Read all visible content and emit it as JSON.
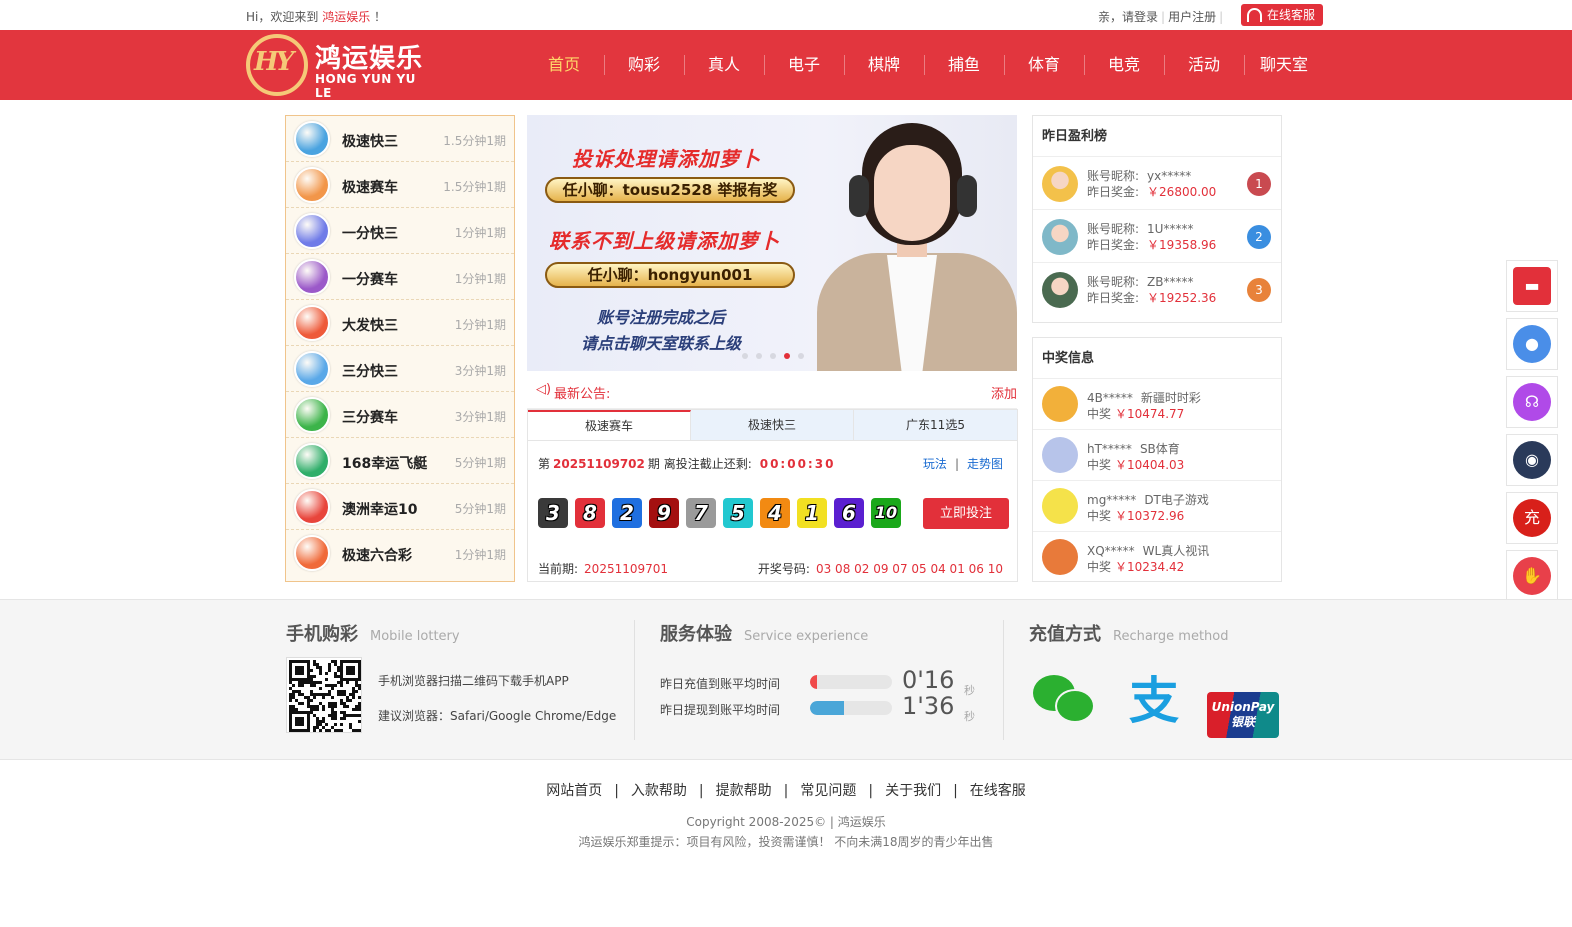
{
  "topbar": {
    "welcome_prefix": "Hi，欢迎来到",
    "brand": "鸿运娱乐",
    "welcome_suffix": "！",
    "greet": "亲，请登录",
    "register": "用户注册",
    "cs_button": "在线客服"
  },
  "logo": {
    "cn": "鸿运娱乐",
    "en": "HONG YUN YU LE",
    "mark": "HY"
  },
  "nav": [
    "首页",
    "购彩",
    "真人",
    "电子",
    "棋牌",
    "捕鱼",
    "体育",
    "电竞",
    "活动",
    "聊天室"
  ],
  "lotteries": [
    {
      "name": "极速快三",
      "period": "1.5分钟1期",
      "color": "#4aa3e0"
    },
    {
      "name": "极速赛车",
      "period": "1.5分钟1期",
      "color": "#f2964a"
    },
    {
      "name": "一分快三",
      "period": "1分钟1期",
      "color": "#6f7be8"
    },
    {
      "name": "一分赛车",
      "period": "1分钟1期",
      "color": "#9b59c9"
    },
    {
      "name": "大发快三",
      "period": "1分钟1期",
      "color": "#ee5a3a"
    },
    {
      "name": "三分快三",
      "period": "3分钟1期",
      "color": "#5aa8e8"
    },
    {
      "name": "三分赛车",
      "period": "3分钟1期",
      "color": "#3cb44a"
    },
    {
      "name": "168幸运飞艇",
      "period": "5分钟1期",
      "color": "#2fae6a"
    },
    {
      "name": "澳洲幸运10",
      "period": "5分钟1期",
      "color": "#e8453c"
    },
    {
      "name": "极速六合彩",
      "period": "1分钟1期",
      "color": "#f06a3a"
    }
  ],
  "banner": {
    "line1": "投诉处理请添加萝卜",
    "pill1": "任小聊：tousu2528 举报有奖",
    "line2": "联系不到上级请添加萝卜",
    "pill2": "任小聊：hongyun001",
    "line3": "账号注册完成之后",
    "line4": "请点击聊天室联系上级"
  },
  "notice": {
    "label": "最新公告:",
    "text": "添加"
  },
  "game": {
    "tabs": [
      "极速赛车",
      "极速快三",
      "广东11选5"
    ],
    "issue_prefix": "第",
    "issue_no": "20251109702",
    "issue_suffix": "期 离投注截止还剩:",
    "timer": "00:00:30",
    "link_play": "玩法",
    "link_trend": "走势图",
    "balls": [
      {
        "n": "3",
        "color": "#3a3a3a"
      },
      {
        "n": "8",
        "color": "#e2303a"
      },
      {
        "n": "2",
        "color": "#1f6fe0"
      },
      {
        "n": "9",
        "color": "#a41010"
      },
      {
        "n": "7",
        "color": "#9a9a9a"
      },
      {
        "n": "5",
        "color": "#22c8d0"
      },
      {
        "n": "4",
        "color": "#f28a12"
      },
      {
        "n": "1",
        "color": "#f2e022"
      },
      {
        "n": "6",
        "color": "#5a1fd0"
      },
      {
        "n": "10",
        "color": "#1aa81a"
      }
    ],
    "bet_button": "立即投注",
    "current_label": "当前期:",
    "current_no": "20251109701",
    "draw_label": "开奖号码:",
    "draw_numbers": "03 08 02 09 07 05 04 01 06 10"
  },
  "rank": {
    "title": "昨日盈利榜",
    "nick_label": "账号昵称:",
    "prize_label": "昨日奖金:",
    "items": [
      {
        "nick": "yx*****",
        "amount": "￥26800.00",
        "rank": "1",
        "color": "#c94a50",
        "avatar": "#f3c14a"
      },
      {
        "nick": "1U*****",
        "amount": "￥19358.96",
        "rank": "2",
        "color": "#3a8ee0",
        "avatar": "#7fb8c8"
      },
      {
        "nick": "ZB*****",
        "amount": "￥19252.36",
        "rank": "3",
        "color": "#e8823a",
        "avatar": "#4a6a50"
      }
    ]
  },
  "wins": {
    "title": "中奖信息",
    "won_label": "中奖",
    "items": [
      {
        "user": "4B*****",
        "game": "新疆时时彩",
        "amount": "￥10474.77",
        "avatar": "#f2b03a"
      },
      {
        "user": "hT*****",
        "game": "SB体育",
        "amount": "￥10404.03",
        "avatar": "#b7c4ea"
      },
      {
        "user": "mg*****",
        "game": "DT电子游戏",
        "amount": "￥10372.96",
        "avatar": "#f5e24a"
      },
      {
        "user": "XQ*****",
        "game": "WL真人视讯",
        "amount": "￥10234.42",
        "avatar": "#e87a3a"
      }
    ]
  },
  "float_buttons": [
    {
      "name": "red-packet-icon",
      "color": "#e2303a",
      "glyph": "▬"
    },
    {
      "name": "group-icon",
      "color": "#4a8ee8",
      "glyph": "●"
    },
    {
      "name": "support-icon",
      "color": "#b04ae8",
      "glyph": "☊"
    },
    {
      "name": "qq-icon",
      "color": "#2a3a5a",
      "glyph": "◉"
    },
    {
      "name": "recharge-icon",
      "color": "#d8201a",
      "glyph": "充"
    },
    {
      "name": "gift-hands-icon",
      "color": "#e8404a",
      "glyph": "✋"
    },
    {
      "name": "barcode-icon",
      "color": "#555555",
      "glyph": "▦"
    }
  ],
  "mobile": {
    "title": "手机购彩",
    "sub": "Mobile lottery",
    "desc1": "手机浏览器扫描二维码下载手机APP",
    "desc2": "建议浏览器：Safari/Google Chrome/Edge"
  },
  "service": {
    "title": "服务体验",
    "sub": "Service experience",
    "deposit_label": "昨日充值到账平均时间",
    "deposit_time": "0'16",
    "deposit_level": 0.08,
    "withdraw_label": "昨日提现到账平均时间",
    "withdraw_time": "1'36",
    "withdraw_level": 0.42,
    "unit": "秒"
  },
  "recharge": {
    "title": "充值方式",
    "sub": "Recharge method",
    "alipay_glyph": "支",
    "union_line1": "UnionPay",
    "union_line2": "银联"
  },
  "footer": {
    "links": [
      "网站首页",
      "入款帮助",
      "提款帮助",
      "常见问题",
      "关于我们",
      "在线客服"
    ],
    "copyright": "Copyright 2008-2025© | 鸿运娱乐",
    "warning": "鸿运娱乐郑重提示：项目有风险，投资需谨慎！  不向未满18周岁的青少年出售"
  }
}
